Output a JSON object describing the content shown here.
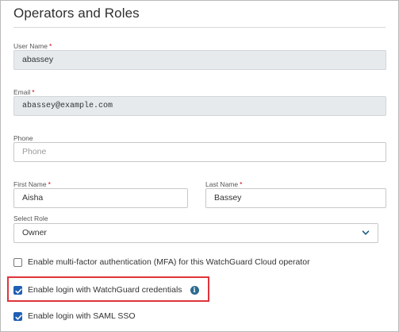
{
  "page": {
    "title": "Operators and Roles"
  },
  "form": {
    "username": {
      "label": "User Name",
      "value": "abassey"
    },
    "email": {
      "label": "Email",
      "value": "abassey@example.com"
    },
    "phone": {
      "label": "Phone",
      "placeholder": "Phone"
    },
    "first_name": {
      "label": "First Name",
      "value": "Aisha"
    },
    "last_name": {
      "label": "Last Name",
      "value": "Bassey"
    },
    "role": {
      "label": "Select Role",
      "value": "Owner"
    },
    "required_mark": "*"
  },
  "options": {
    "mfa": {
      "label": "Enable multi-factor authentication (MFA) for this WatchGuard Cloud operator",
      "checked": false
    },
    "watchguard_login": {
      "label": "Enable login with WatchGuard credentials",
      "checked": true,
      "info_glyph": "i"
    },
    "saml_login": {
      "label": "Enable login with SAML SSO",
      "checked": true
    }
  },
  "colors": {
    "accent": "#1f5fb4",
    "highlight": "#e0343a",
    "readonly_bg": "#e6eaed"
  }
}
